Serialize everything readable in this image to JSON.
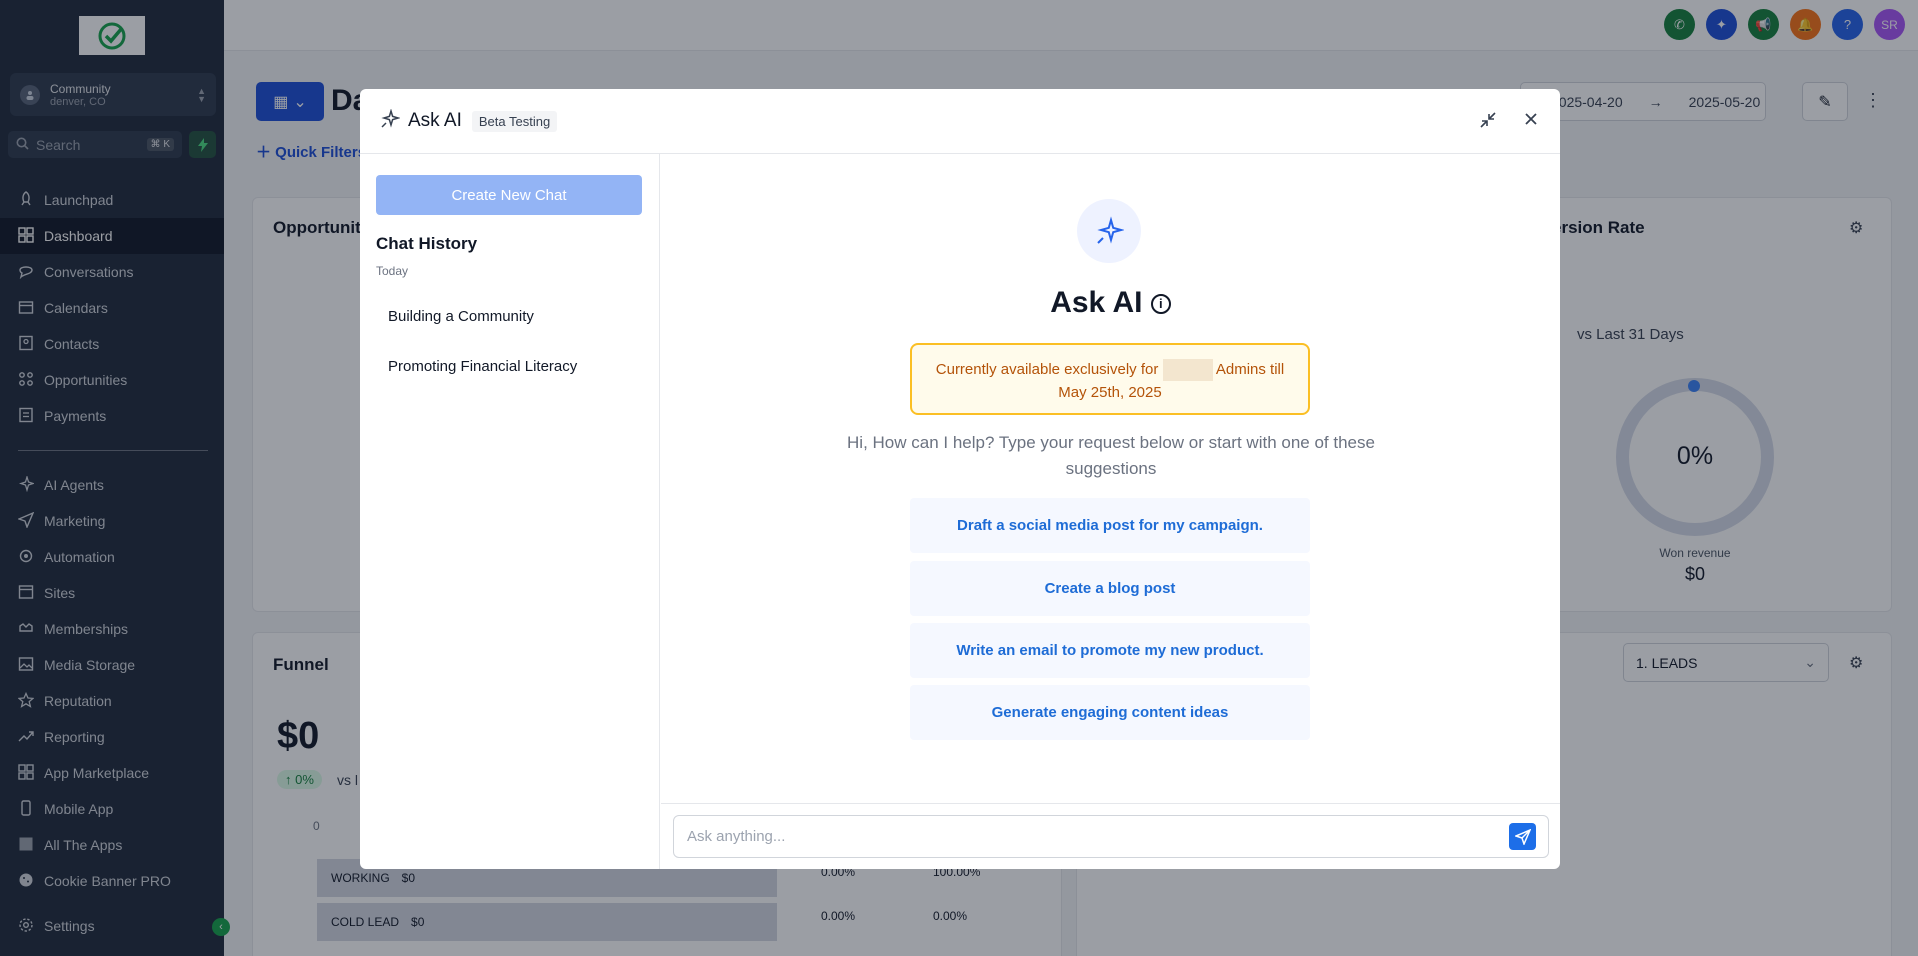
{
  "sidebar": {
    "location": {
      "name": "Community",
      "sub": "denver, CO"
    },
    "search": {
      "placeholder": "Search",
      "shortcut": "⌘ K"
    },
    "items": [
      {
        "label": "Launchpad",
        "icon": "rocket-icon"
      },
      {
        "label": "Dashboard",
        "icon": "grid-icon",
        "active": true
      },
      {
        "label": "Conversations",
        "icon": "chat-icon"
      },
      {
        "label": "Calendars",
        "icon": "calendar-icon"
      },
      {
        "label": "Contacts",
        "icon": "contacts-icon"
      },
      {
        "label": "Opportunities",
        "icon": "opportunities-icon"
      },
      {
        "label": "Payments",
        "icon": "payments-icon"
      },
      {
        "label": "AI Agents",
        "icon": "sparkle-icon"
      },
      {
        "label": "Marketing",
        "icon": "send-icon"
      },
      {
        "label": "Automation",
        "icon": "automation-icon"
      },
      {
        "label": "Sites",
        "icon": "sites-icon"
      },
      {
        "label": "Memberships",
        "icon": "memberships-icon"
      },
      {
        "label": "Media Storage",
        "icon": "image-icon"
      },
      {
        "label": "Reputation",
        "icon": "star-icon"
      },
      {
        "label": "Reporting",
        "icon": "trend-icon"
      },
      {
        "label": "App Marketplace",
        "icon": "apps-icon"
      },
      {
        "label": "Mobile App",
        "icon": "mobile-icon"
      },
      {
        "label": "All The Apps",
        "icon": "app-tile-icon"
      },
      {
        "label": "Cookie Banner PRO",
        "icon": "cookie-icon"
      },
      {
        "label": "Settings",
        "icon": "gear-icon"
      }
    ]
  },
  "topbar": {
    "avatar": "SR",
    "colors": {
      "phone": "#15803d",
      "ai": "#1d4ed8",
      "megaphone": "#15803d",
      "bell": "#f97316",
      "help": "#2563eb",
      "avatar": "#a855f7"
    }
  },
  "dashboard": {
    "title": "Da",
    "quick_filters": "Quick Filters",
    "date_from": "2025-04-20",
    "date_to": "2025-05-20",
    "opportunity_title": "Opportunity",
    "conversion_title": "ersion Rate",
    "vs_label": "vs Last 31 Days",
    "gauge_value": "0%",
    "won_label": "Won revenue",
    "won_value": "$0",
    "funnel_title": "Funnel",
    "funnel_value": "$0",
    "funnel_change": "0%",
    "funnel_vs": "vs l",
    "axis_zero": "0",
    "stage_select": "1. LEADS",
    "rows": [
      {
        "stage": "WORKING",
        "amount": "$0",
        "pct1": "0.00%",
        "pct2": "100.00%"
      },
      {
        "stage": "COLD LEAD",
        "amount": "$0",
        "pct1": "0.00%",
        "pct2": "0.00%"
      }
    ]
  },
  "modal": {
    "title": "Ask AI",
    "badge": "Beta Testing",
    "new_chat": "Create New Chat",
    "history_title": "Chat History",
    "history_group": "Today",
    "history": [
      "Building a Community",
      "Promoting Financial Literacy"
    ],
    "hero_title": "Ask AI",
    "notice_pre": "Currently available exclusively for",
    "notice_post": "Admins till",
    "notice_date": "May 25th, 2025",
    "intro": "Hi, How can I help? Type your request below or start with one of these suggestions",
    "suggestions": [
      "Draft a social media post for my campaign.",
      "Create a blog post",
      "Write an email to promote my new product.",
      "Generate engaging content ideas"
    ],
    "input_placeholder": "Ask anything..."
  }
}
